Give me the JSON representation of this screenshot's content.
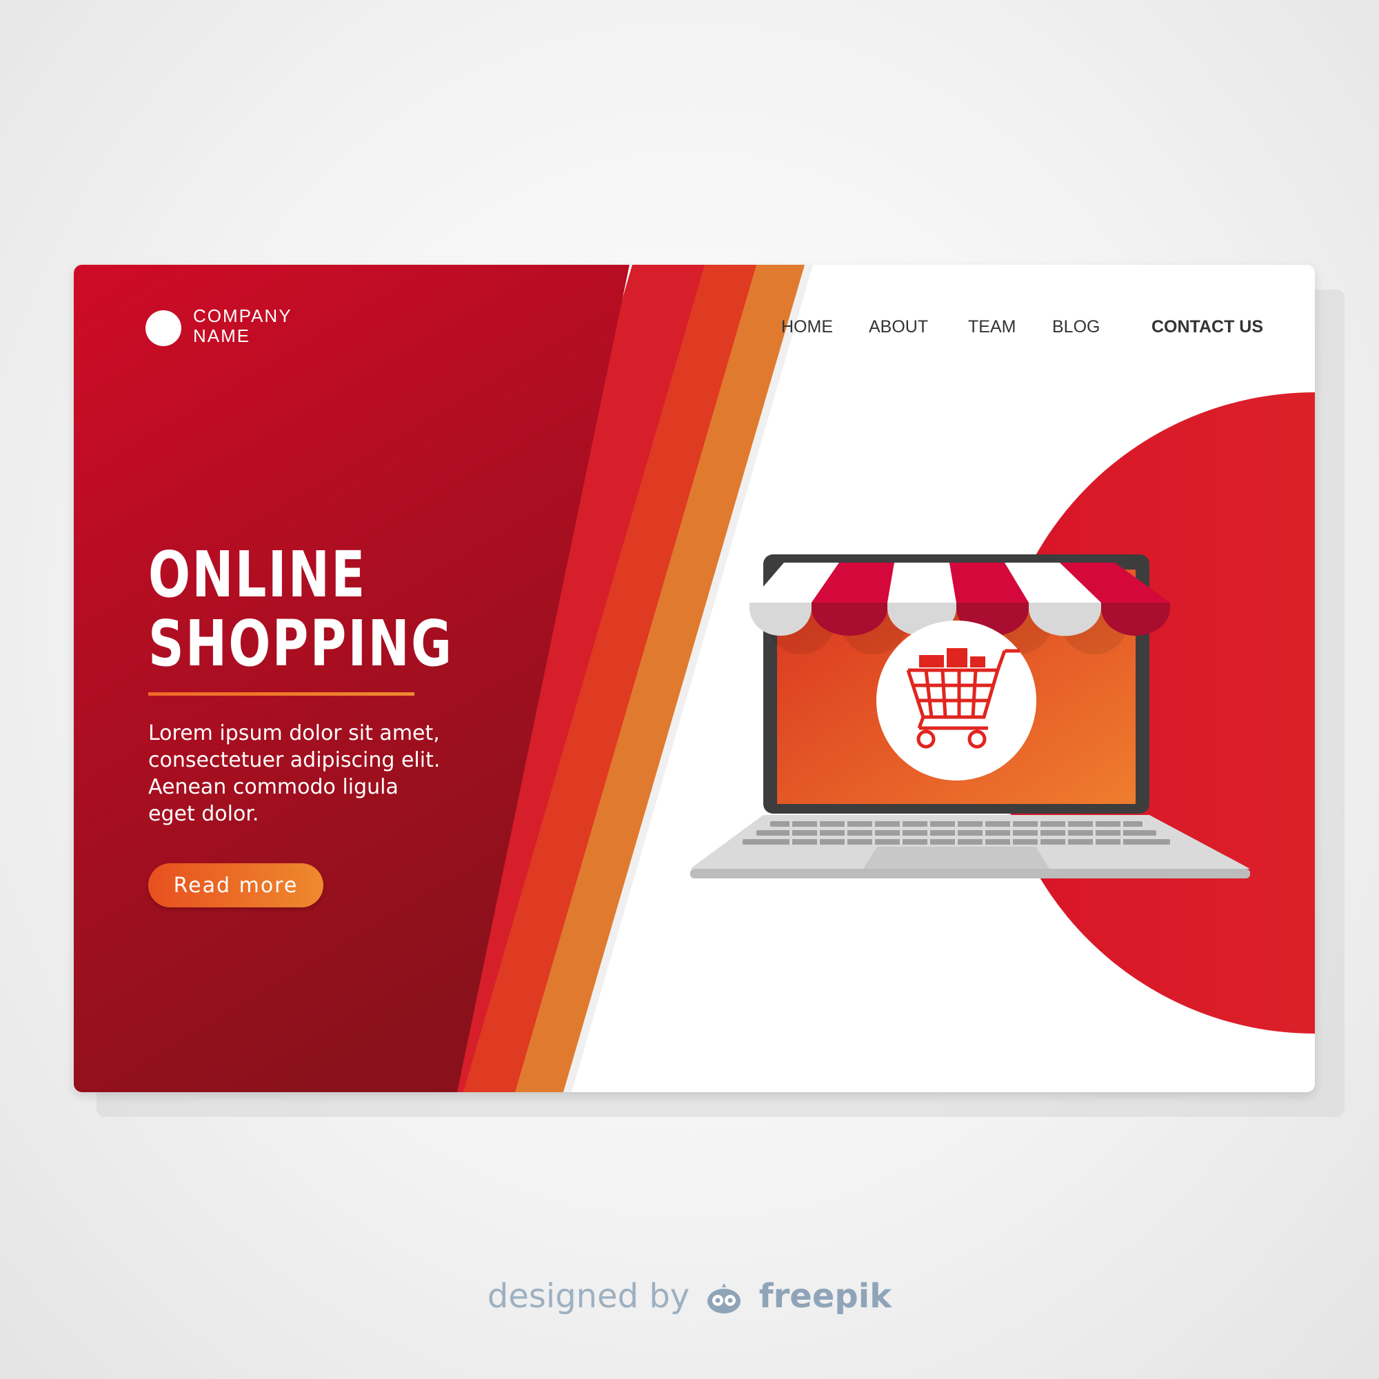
{
  "brand": {
    "name": "COMPANY NAME",
    "name_line1": "COMPANY",
    "name_line2": "NAME"
  },
  "nav": {
    "items": [
      {
        "label": "HOME"
      },
      {
        "label": "ABOUT"
      },
      {
        "label": "TEAM"
      },
      {
        "label": "BLOG"
      },
      {
        "label": "CONTACT US"
      }
    ]
  },
  "hero": {
    "title_line1": "ONLINE",
    "title_line2": "SHOPPING",
    "body_line1": "Lorem ipsum dolor sit amet,",
    "body_line2": "consectetuer adipiscing elit.",
    "body_line3": "Aenean commodo ligula",
    "body_line4": "eget dolor.",
    "cta_label": "Read more"
  },
  "illustration": {
    "icons": [
      "laptop-icon",
      "awning-icon",
      "shopping-cart-icon"
    ]
  },
  "credit": {
    "prefix": "designed by",
    "brand": "freepik"
  },
  "colors": {
    "primary_red": "#c8102e",
    "dark_red": "#8e1219",
    "orange": "#ee7b2a",
    "accent_circle": "#dc2a2a"
  }
}
